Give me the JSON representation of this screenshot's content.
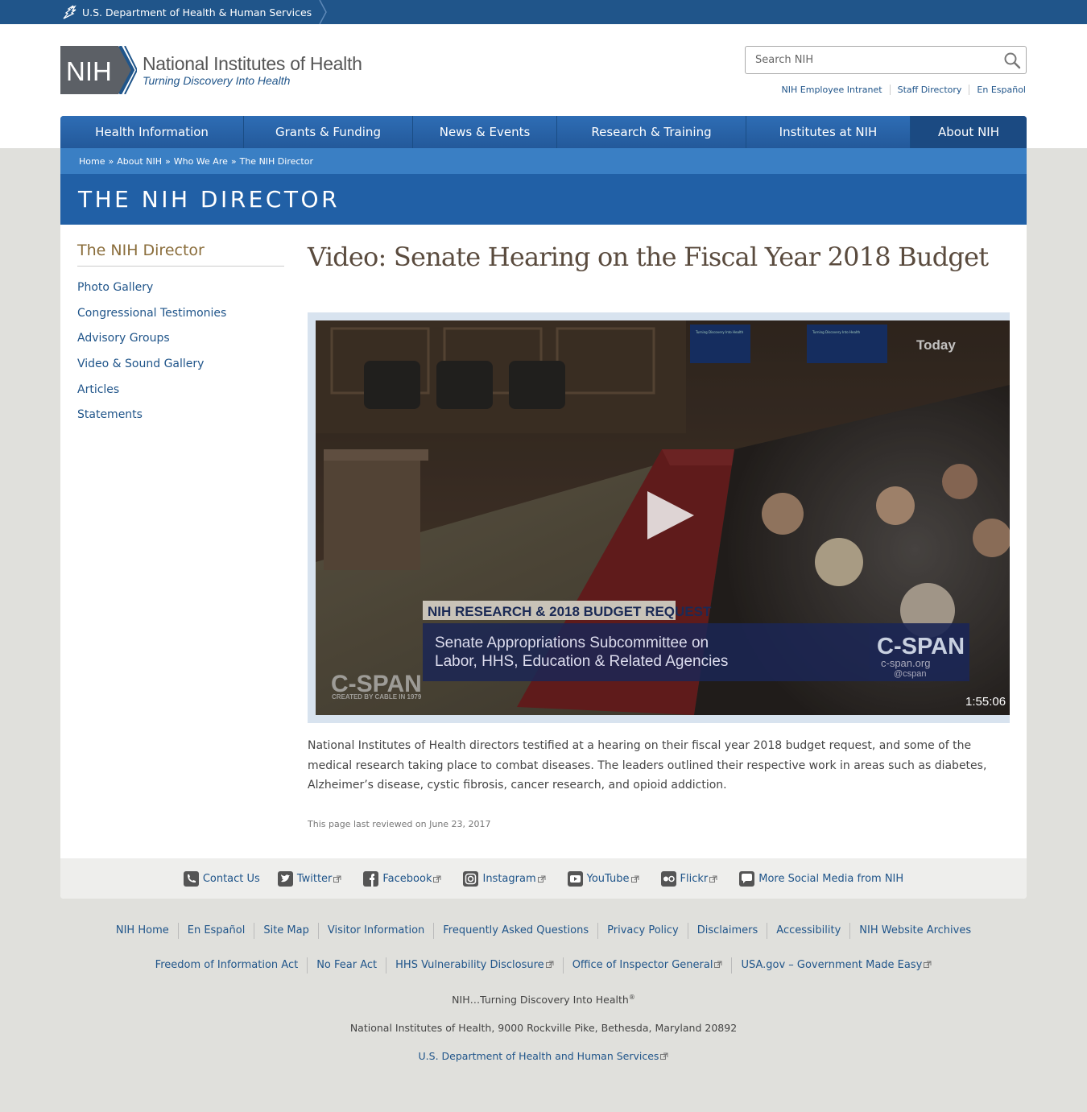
{
  "hhs_bar": {
    "label": "U.S. Department of Health & Human Services"
  },
  "logo": {
    "mark_text": "NIH",
    "title": "National Institutes of Health",
    "tagline": "Turning Discovery Into Health"
  },
  "search": {
    "placeholder": "Search NIH"
  },
  "utility_links": [
    "NIH Employee Intranet",
    "Staff Directory",
    "En Español"
  ],
  "nav": [
    {
      "label": "Health Information"
    },
    {
      "label": "Grants & Funding"
    },
    {
      "label": "News & Events"
    },
    {
      "label": "Research & Training"
    },
    {
      "label": "Institutes at NIH"
    },
    {
      "label": "About NIH",
      "active": true
    }
  ],
  "breadcrumb": [
    "Home",
    "About NIH",
    "Who We Are",
    "The NIH Director"
  ],
  "section_title": "THE NIH DIRECTOR",
  "sidebar": {
    "title": "The NIH Director",
    "items": [
      "Photo Gallery",
      "Congressional Testimonies",
      "Advisory Groups",
      "Video & Sound Gallery",
      "Articles",
      "Statements"
    ]
  },
  "content": {
    "title": "Video: Senate Hearing on the Fiscal Year 2018 Budget",
    "video": {
      "corner_label": "Today",
      "lower_third_header": "NIH RESEARCH & 2018 BUDGET REQUEST",
      "lower_third_line1": "Senate Appropriations Subcommittee on",
      "lower_third_line2": "Labor, HHS, Education & Related Agencies",
      "network_logo": "C-SPAN",
      "network_tagline": "CREATED BY CABLE IN 1979",
      "badge_logo": "C-SPAN",
      "badge_url": "c-span.org",
      "badge_handle": "@cspan",
      "duration": "1:55:06",
      "monitor_label": "Turning Discovery Into Health"
    },
    "description": "National Institutes of Health directors testified at a hearing on their fiscal year 2018 budget request, and some of the medical research taking place to combat diseases. The leaders outlined their respective work in areas such as diabetes, Alzheimer’s disease, cystic fibrosis, cancer research, and opioid addiction.",
    "last_reviewed": "This page last reviewed on June 23, 2017"
  },
  "social": [
    {
      "label": "Contact Us",
      "icon": "phone-icon",
      "external": false
    },
    {
      "label": "Twitter",
      "icon": "twitter-icon",
      "external": true
    },
    {
      "label": "Facebook",
      "icon": "facebook-icon",
      "external": true
    },
    {
      "label": "Instagram",
      "icon": "instagram-icon",
      "external": true
    },
    {
      "label": "YouTube",
      "icon": "youtube-icon",
      "external": true
    },
    {
      "label": "Flickr",
      "icon": "flickr-icon",
      "external": true
    },
    {
      "label": "More Social Media from NIH",
      "icon": "chat-icon",
      "external": false
    }
  ],
  "footer_row1": [
    "NIH Home",
    "En Español",
    "Site Map",
    "Visitor Information",
    "Frequently Asked Questions",
    "Privacy Policy",
    "Disclaimers",
    "Accessibility",
    "NIH Website Archives"
  ],
  "footer_row2": [
    {
      "label": "Freedom of Information Act",
      "external": false
    },
    {
      "label": "No Fear Act",
      "external": false
    },
    {
      "label": "HHS Vulnerability Disclosure",
      "external": true
    },
    {
      "label": "Office of Inspector General",
      "external": true
    },
    {
      "label": "USA.gov – Government Made Easy",
      "external": true
    }
  ],
  "footer_tagline": "NIH…Turning Discovery Into Health",
  "footer_tagline_mark": "®",
  "footer_address": "National Institutes of Health, 9000 Rockville Pike, Bethesda, Maryland 20892",
  "footer_hhs_link": "U.S. Department of Health and Human Services",
  "colors": {
    "hhs_bar": "#20558a",
    "nav": "#2966ab",
    "banner": "#2160a6",
    "breadcrumb": "#3a7fc4",
    "link": "#20558a",
    "sidebar_title": "#8a6d3b"
  }
}
